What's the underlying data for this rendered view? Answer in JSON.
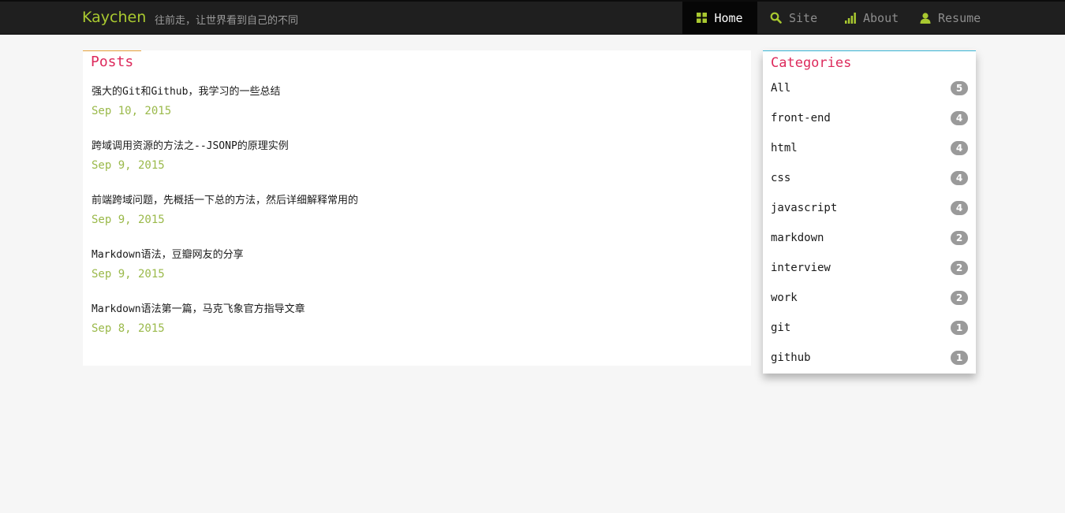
{
  "header": {
    "brand": "Kaychen",
    "tagline": "往前走，让世界看到自己的不同",
    "nav": [
      {
        "label": "Home",
        "icon": "grid-icon",
        "active": true
      },
      {
        "label": "Site",
        "icon": "search-icon",
        "active": false
      },
      {
        "label": "About",
        "icon": "signal-bars-icon",
        "active": false
      },
      {
        "label": "Resume",
        "icon": "user-icon",
        "active": false
      }
    ]
  },
  "posts": {
    "title": "Posts",
    "items": [
      {
        "title": "强大的Git和Github，我学习的一些总结",
        "date": "Sep 10, 2015"
      },
      {
        "title": "跨域调用资源的方法之--JSONP的原理实例",
        "date": "Sep 9, 2015"
      },
      {
        "title": "前端跨域问题，先概括一下总的方法，然后详细解释常用的",
        "date": "Sep 9, 2015"
      },
      {
        "title": "Markdown语法，豆瓣网友的分享",
        "date": "Sep 9, 2015"
      },
      {
        "title": "Markdown语法第一篇，马克飞象官方指导文章",
        "date": "Sep 8, 2015"
      }
    ]
  },
  "categories": {
    "title": "Categories",
    "items": [
      {
        "label": "All",
        "count": "5"
      },
      {
        "label": "front-end",
        "count": "4"
      },
      {
        "label": "html",
        "count": "4"
      },
      {
        "label": "css",
        "count": "4"
      },
      {
        "label": "javascript",
        "count": "4"
      },
      {
        "label": "markdown",
        "count": "2"
      },
      {
        "label": "interview",
        "count": "2"
      },
      {
        "label": "work",
        "count": "2"
      },
      {
        "label": "git",
        "count": "1"
      },
      {
        "label": "github",
        "count": "1"
      }
    ]
  },
  "colors": {
    "navbar": "#1f1f1f",
    "brand": "#a9c930",
    "accent_pink": "#dd2a5c",
    "date_green": "#9ab94a",
    "badge": "#9a9a9a",
    "categories_border": "#3bb6d6",
    "posts_border": "#e6a23c"
  }
}
